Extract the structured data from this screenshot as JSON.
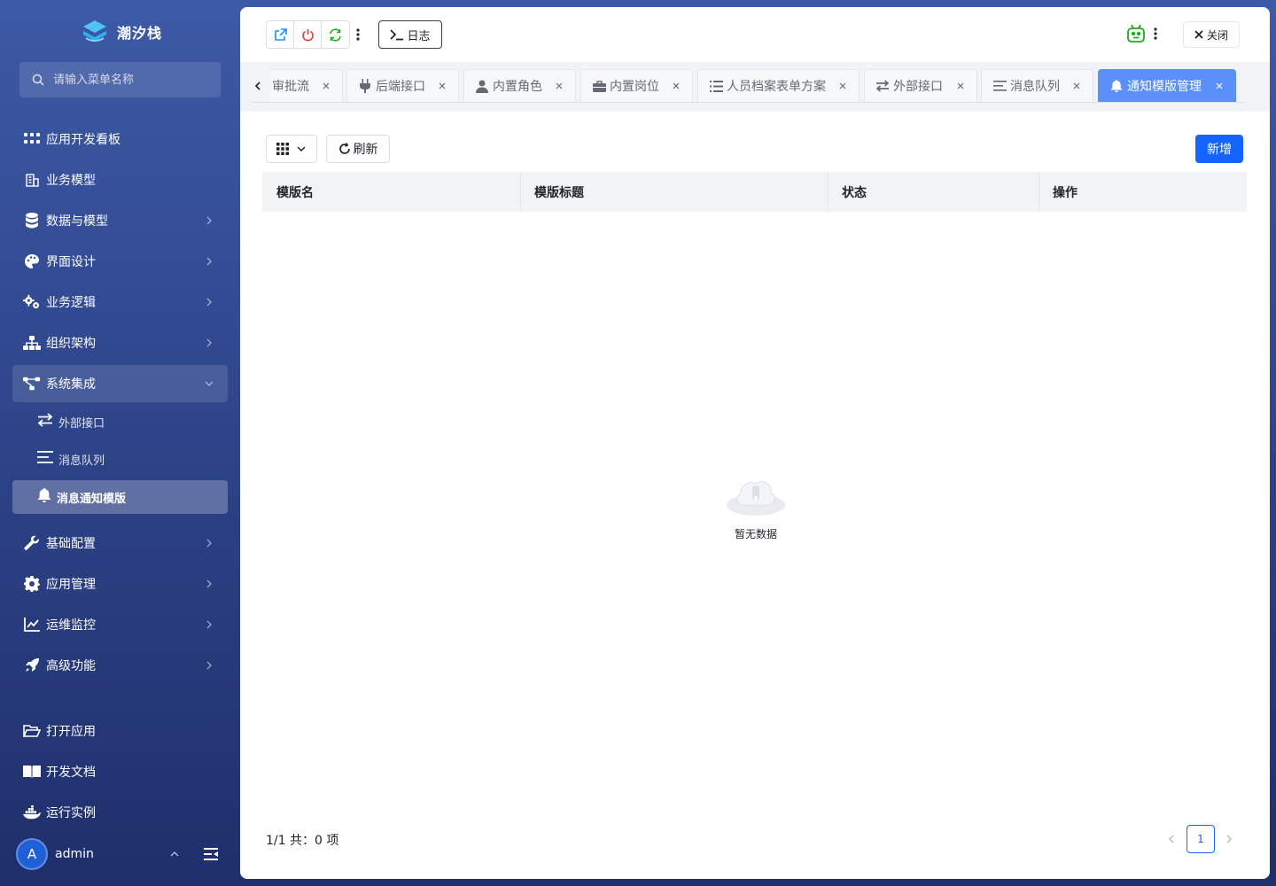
{
  "app": {
    "name": "潮汐栈"
  },
  "sidebar": {
    "search_placeholder": "请输入菜单名称",
    "items": [
      {
        "label": "应用开发看板",
        "icon": "grid-dots-icon"
      },
      {
        "label": "业务模型",
        "icon": "building-icon"
      },
      {
        "label": "数据与模型",
        "icon": "database-icon"
      },
      {
        "label": "界面设计",
        "icon": "palette-icon"
      },
      {
        "label": "业务逻辑",
        "icon": "gears-icon"
      },
      {
        "label": "组织架构",
        "icon": "org-chart-icon"
      },
      {
        "label": "系统集成",
        "icon": "network-icon"
      },
      {
        "label": "基础配置",
        "icon": "wrench-icon"
      },
      {
        "label": "应用管理",
        "icon": "gear-icon"
      },
      {
        "label": "运维监控",
        "icon": "line-chart-icon"
      },
      {
        "label": "高级功能",
        "icon": "rocket-icon"
      }
    ],
    "submenu": [
      {
        "label": "外部接口",
        "icon": "swap-arrows-icon"
      },
      {
        "label": "消息队列",
        "icon": "list-lines-icon"
      },
      {
        "label": "消息通知模版",
        "icon": "bell-icon"
      }
    ],
    "bottom": [
      {
        "label": "打开应用",
        "icon": "folder-open-icon"
      },
      {
        "label": "开发文档",
        "icon": "book-icon"
      },
      {
        "label": "运行实例",
        "icon": "docker-icon"
      }
    ],
    "user": {
      "avatar_letter": "A",
      "name": "admin"
    }
  },
  "toolbar": {
    "log_label": "日志",
    "close_label": "关闭"
  },
  "tabs": [
    {
      "label": "审批流",
      "icon": ""
    },
    {
      "label": "后端接口",
      "icon": "plug-icon"
    },
    {
      "label": "内置角色",
      "icon": "user-tie-icon"
    },
    {
      "label": "内置岗位",
      "icon": "briefcase-icon"
    },
    {
      "label": "人员档案表单方案",
      "icon": "list-icon"
    },
    {
      "label": "外部接口",
      "icon": "swap-arrows-icon"
    },
    {
      "label": "消息队列",
      "icon": "list-lines-icon"
    },
    {
      "label": "通知模版管理",
      "icon": "bell-icon",
      "active": true
    }
  ],
  "content": {
    "refresh_label": "刷新",
    "add_label": "新增",
    "columns": [
      "模版名",
      "模版标题",
      "状态",
      "操作"
    ],
    "empty_text": "暂无数据",
    "summary": "1/1 共：0 项",
    "current_page": "1"
  },
  "colors": {
    "primary": "#1664ff",
    "active_tab": "#5b8ff9",
    "sidebar_top": "#3d5aa6",
    "sidebar_bottom": "#1f2f6b"
  }
}
